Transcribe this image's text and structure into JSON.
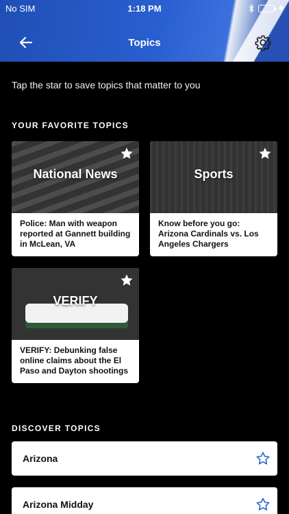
{
  "status_bar": {
    "carrier": "No SIM",
    "time": "1:18 PM"
  },
  "header": {
    "title": "Topics"
  },
  "intro_text": "Tap the star to save topics that matter to you",
  "favorites": {
    "section_title": "YOUR FAVORITE TOPICS",
    "cards": [
      {
        "name": "National News",
        "headline": "Police: Man with weapon reported at Gannett building in McLean, VA"
      },
      {
        "name": "Sports",
        "headline": "Know before you go: Arizona Cardinals vs. Los Angeles Chargers"
      },
      {
        "name": "VERIFY",
        "headline": "VERIFY: Debunking false online claims about the El Paso and Dayton shootings"
      }
    ]
  },
  "discover": {
    "section_title": "DISCOVER TOPICS",
    "items": [
      {
        "label": "Arizona"
      },
      {
        "label": "Arizona Midday"
      }
    ]
  },
  "colors": {
    "header_blue": "#2a5fd0",
    "accent_blue": "#1f4fb5",
    "battery_green": "#4cd964"
  }
}
